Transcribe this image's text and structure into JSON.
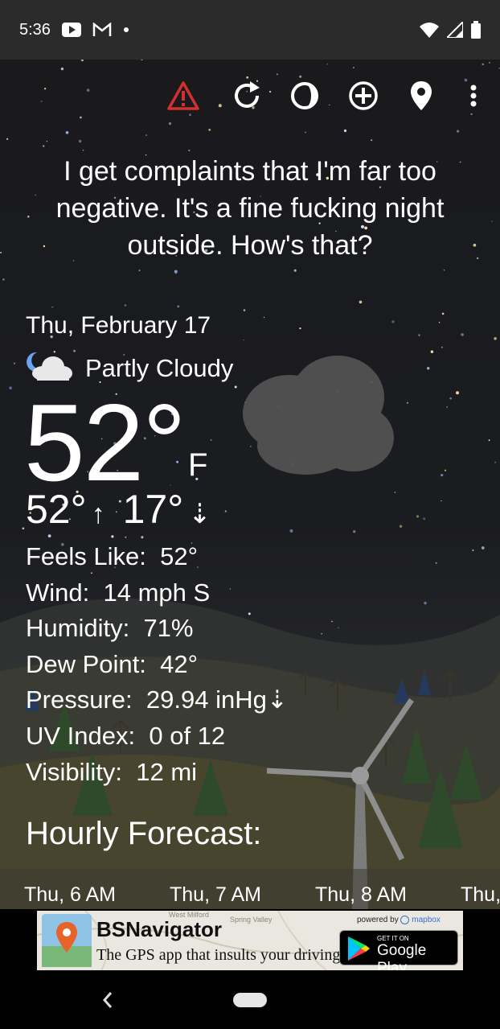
{
  "status_bar": {
    "time": "5:36",
    "left_icons": [
      "youtube-icon",
      "gmail-icon",
      "dot-icon"
    ],
    "right_icons": [
      "wifi-icon",
      "signal-icon",
      "battery-icon"
    ]
  },
  "toolbar": {
    "icons": [
      "warning-icon",
      "refresh-icon",
      "theme-icon",
      "add-location-icon",
      "location-pin-icon",
      "more-vert-icon"
    ],
    "warning_color": "#d32f2f"
  },
  "quote": "I get complaints that I'm far too negative. It's a fine fucking night outside. How's that?",
  "current": {
    "date": "Thu, February 17",
    "condition": "Partly Cloudy",
    "condition_icon": "partly-cloudy-night-icon",
    "temperature": "52°",
    "unit": "F",
    "high": "52°",
    "high_arrow": "↑",
    "low": "17°",
    "low_arrow": "⇣"
  },
  "details": [
    {
      "label": "Feels Like:",
      "value": "52°"
    },
    {
      "label": "Wind:",
      "value": "14 mph S"
    },
    {
      "label": "Humidity:",
      "value": "71%"
    },
    {
      "label": "Dew Point:",
      "value": "42°"
    },
    {
      "label": "Pressure:",
      "value": "29.94 inHg⇣"
    },
    {
      "label": "UV Index:",
      "value": "0 of 12"
    },
    {
      "label": "Visibility:",
      "value": "12 mi"
    }
  ],
  "hourly": {
    "title": "Hourly Forecast:",
    "items": [
      "Thu, 6 AM",
      "Thu, 7 AM",
      "Thu, 8 AM",
      "Thu,"
    ]
  },
  "ad": {
    "title": "BSNavigator",
    "subtitle": "The GPS app that insults your driving.",
    "powered_by": "powered by",
    "powered_brand": "mapbox",
    "store_small": "GET IT ON",
    "store_name": "Google Play",
    "map_labels": [
      "West Milford",
      "Spring Valley"
    ]
  },
  "nav": {
    "back": "‹"
  }
}
